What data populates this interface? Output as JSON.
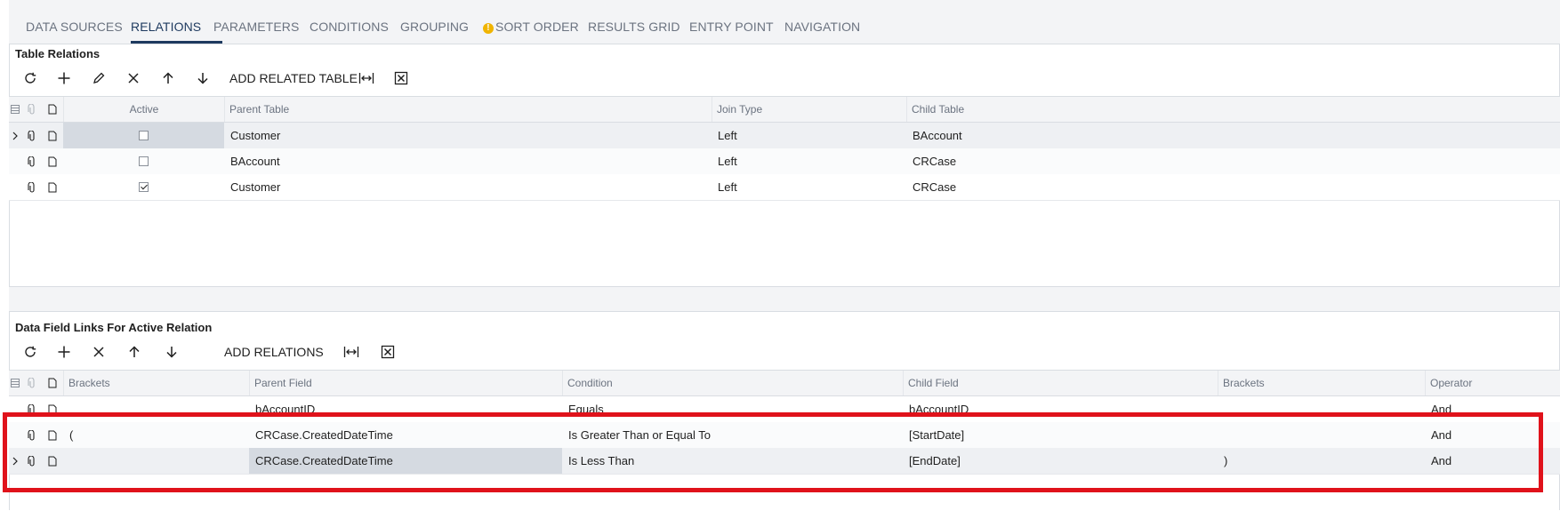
{
  "tabs": [
    {
      "label": "DATA SOURCES",
      "active": false
    },
    {
      "label": "RELATIONS",
      "active": true
    },
    {
      "label": "PARAMETERS",
      "active": false
    },
    {
      "label": "CONDITIONS",
      "active": false
    },
    {
      "label": "GROUPING",
      "active": false
    },
    {
      "label": "SORT ORDER",
      "active": false,
      "warning_icon": "warning-icon"
    },
    {
      "label": "RESULTS GRID",
      "active": false
    },
    {
      "label": "ENTRY POINT",
      "active": false
    },
    {
      "label": "NAVIGATION",
      "active": false
    }
  ],
  "table_relations": {
    "title": "Table Relations",
    "toolbar": {
      "refresh_icon": "refresh-icon",
      "add_icon": "plus-icon",
      "edit_icon": "pencil-icon",
      "delete_icon": "close-icon",
      "up_icon": "arrow-up-icon",
      "down_icon": "arrow-down-icon",
      "add_related_table_label": "ADD RELATED TABLE",
      "fit_icon": "fit-columns-icon",
      "excel_icon": "excel-export-icon"
    },
    "columns": [
      "Active",
      "Parent Table",
      "Join Type",
      "Child Table"
    ],
    "rows": [
      {
        "active": false,
        "parent_table": "Customer",
        "join_type": "Left",
        "child_table": "BAccount",
        "current": true
      },
      {
        "active": false,
        "parent_table": "BAccount",
        "join_type": "Left",
        "child_table": "CRCase",
        "current": false
      },
      {
        "active": true,
        "parent_table": "Customer",
        "join_type": "Left",
        "child_table": "CRCase",
        "current": false
      }
    ]
  },
  "data_field_links": {
    "title": "Data Field Links For Active Relation",
    "toolbar": {
      "refresh_icon": "refresh-icon",
      "add_icon": "plus-icon",
      "delete_icon": "close-icon",
      "up_icon": "arrow-up-icon",
      "down_icon": "arrow-down-icon",
      "add_relations_label": "ADD RELATIONS",
      "fit_icon": "fit-columns-icon",
      "excel_icon": "excel-export-icon"
    },
    "columns": [
      "Brackets",
      "Parent Field",
      "Condition",
      "Child Field",
      "Brackets",
      "Operator"
    ],
    "rows": [
      {
        "open_bracket": "",
        "parent_field": "bAccountID",
        "condition": "Equals",
        "child_field": "bAccountID",
        "close_bracket": "",
        "operator": "And",
        "current": false
      },
      {
        "open_bracket": "(",
        "parent_field": "CRCase.CreatedDateTime",
        "condition": "Is Greater Than or Equal To",
        "child_field": "[StartDate]",
        "close_bracket": "",
        "operator": "And",
        "current": false
      },
      {
        "open_bracket": "",
        "parent_field": "CRCase.CreatedDateTime",
        "condition": "Is Less Than",
        "child_field": "[EndDate]",
        "close_bracket": ")",
        "operator": "And",
        "current": true
      }
    ]
  },
  "colors": {
    "accent": "#1e3a5f",
    "highlight_box": "#e0121b",
    "warning": "#f0b400",
    "selected_cell": "#d5dae1"
  }
}
